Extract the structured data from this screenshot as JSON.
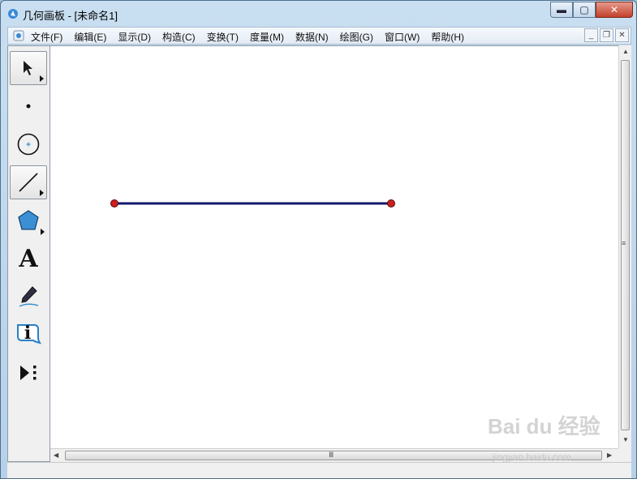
{
  "window": {
    "title": "几何画板 - [未命名1]",
    "controls": {
      "minimize": "▬",
      "maximize": "▢",
      "close": "✕"
    }
  },
  "menubar": {
    "items": [
      "文件(F)",
      "编辑(E)",
      "显示(D)",
      "构造(C)",
      "变换(T)",
      "度量(M)",
      "数据(N)",
      "绘图(G)",
      "窗口(W)",
      "帮助(H)"
    ],
    "mdi_controls": {
      "minimize": "_",
      "restore": "❐",
      "close": "✕"
    }
  },
  "toolbox": {
    "tools": [
      {
        "name": "selection-arrow-tool",
        "icon": "arrow-cursor-icon",
        "selected": true,
        "has_submenu": true
      },
      {
        "name": "point-tool",
        "icon": "point-icon",
        "selected": false,
        "has_submenu": false
      },
      {
        "name": "compass-tool",
        "icon": "circle-icon",
        "selected": false,
        "has_submenu": false
      },
      {
        "name": "straightedge-tool",
        "icon": "segment-icon",
        "selected": true,
        "has_submenu": true
      },
      {
        "name": "polygon-tool",
        "icon": "polygon-icon",
        "selected": false,
        "has_submenu": true
      },
      {
        "name": "text-tool",
        "icon": "text-a-icon",
        "text": "A",
        "selected": false,
        "has_submenu": false
      },
      {
        "name": "marker-tool",
        "icon": "marker-pen-icon",
        "selected": false,
        "has_submenu": false
      },
      {
        "name": "information-tool",
        "icon": "info-icon",
        "text": "i",
        "selected": false,
        "has_submenu": false
      },
      {
        "name": "custom-tool",
        "icon": "play-custom-icon",
        "selected": false,
        "has_submenu": false
      }
    ]
  },
  "canvas": {
    "segment": {
      "color": "#101a6b",
      "endpoint_color": "#cc1f1f"
    }
  },
  "scrollbars": {
    "h_grip": "Ⅲ",
    "v_grip": "≡",
    "arrows": {
      "up": "▲",
      "down": "▼",
      "left": "◀",
      "right": "▶"
    }
  },
  "watermark": {
    "main": "Bai du 经验",
    "sub": "jingyan.baidu.com"
  },
  "colors": {
    "title_bar": "#c9dff1",
    "close_button": "#c2412b",
    "canvas_bg": "#ffffff"
  }
}
